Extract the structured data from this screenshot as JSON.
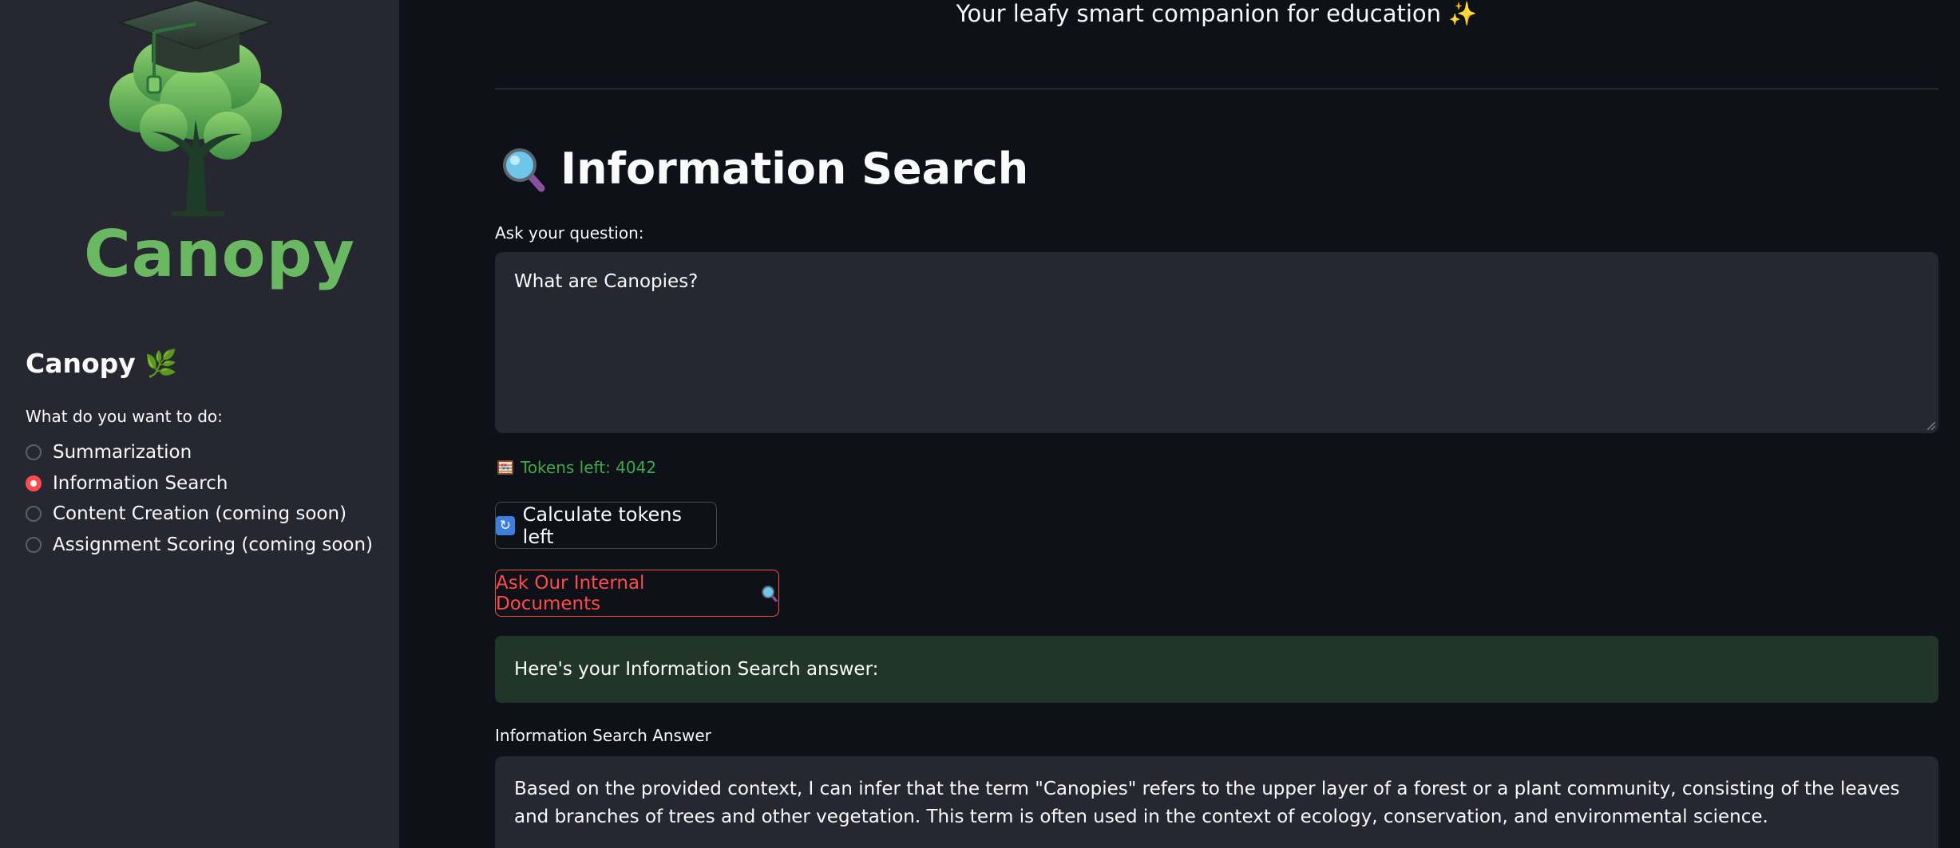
{
  "sidebar": {
    "logo_text": "Canopy",
    "title": "Canopy 🌿",
    "question": "What do you want to do:",
    "options": [
      {
        "label": "Summarization",
        "selected": false
      },
      {
        "label": "Information Search",
        "selected": true
      },
      {
        "label": "Content Creation (coming soon)",
        "selected": false
      },
      {
        "label": "Assignment Scoring (coming soon)",
        "selected": false
      }
    ]
  },
  "main": {
    "tagline": "Your leafy smart companion for education ✨",
    "heading": "Information Search",
    "input_label": "Ask your question:",
    "input_value": "What are Canopies?",
    "tokens_text": "Tokens left: 4042",
    "calc_button": "Calculate tokens left",
    "ask_button": "Ask Our Internal Documents",
    "success_message": "Here's your Information Search answer:",
    "answer_label": "Information Search Answer",
    "answer_text": "Based on the provided context, I can infer that the term \"Canopies\" refers to the upper layer of a forest or a plant community, consisting of the leaves and branches of trees and other vegetation. This term is often used in the context of ecology, conservation, and environmental science."
  },
  "colors": {
    "accent": "#ff4b4b",
    "success_bg": "#213529",
    "tokens_text": "#3fa94a",
    "logo_green": "#6bb862"
  },
  "icons": {
    "heading": "magnifying-glass-icon",
    "tokens": "abacus-icon",
    "calc_button": "refresh-icon",
    "ask_button": "magnifying-glass-icon"
  }
}
